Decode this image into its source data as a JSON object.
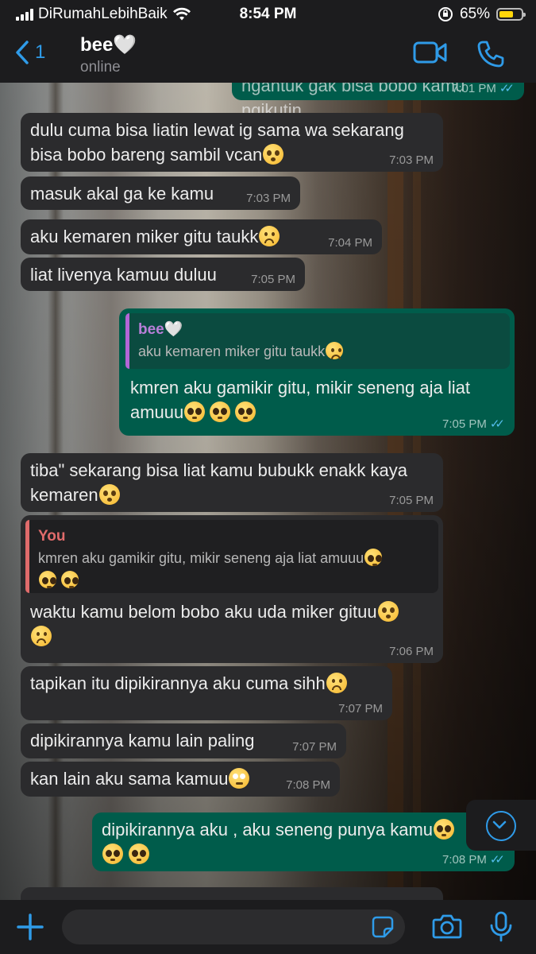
{
  "status_bar": {
    "carrier": "DiRumahLebihBaik",
    "time": "8:54 PM",
    "battery": "65%",
    "battery_level": 0.65
  },
  "header": {
    "back_count": "1",
    "contact_name": "bee🤍",
    "contact_status": "online",
    "icons": [
      "chevron-left-icon",
      "video-call-icon",
      "phone-icon"
    ]
  },
  "messages": [
    {
      "dir": "out",
      "text": "ngantuk gak bisa bobo kamu ngikutin",
      "time": "7:01 PM"
    },
    {
      "dir": "in",
      "text": "dulu cuma bisa liatin lewat ig sama wa sekarang bisa bobo bareng sambil vcan",
      "emoji": [
        "flushed"
      ],
      "time": "7:03 PM"
    },
    {
      "dir": "in",
      "text": "masuk akal ga ke kamu",
      "time": "7:03 PM"
    },
    {
      "dir": "in",
      "text": "aku kemaren miker gitu taukk",
      "emoji": [
        "frowning"
      ],
      "time": "7:04 PM"
    },
    {
      "dir": "in",
      "text": "liat livenya kamuu duluu",
      "time": "7:05 PM"
    },
    {
      "dir": "out",
      "quote_author": "bee🤍",
      "quote_text": "aku kemaren miker gitu taukk",
      "text": "kmren aku gamikir gitu, mikir seneng aja liat amuuu",
      "emoji": [
        "pleading",
        "pleading",
        "pleading"
      ],
      "time": "7:05 PM"
    },
    {
      "dir": "in",
      "text": "tiba\" sekarang bisa liat kamu bubukk enakk kaya kemaren",
      "emoji": [
        "flushed"
      ],
      "time": "7:05 PM"
    },
    {
      "dir": "in",
      "quote_author": "You",
      "quote_text": "kmren aku gamikir gitu, mikir seneng aja liat amuuu",
      "text": "waktu kamu belom bobo aku uda miker gituu",
      "emoji": [
        "flushed",
        "frowning"
      ],
      "time": "7:06 PM"
    },
    {
      "dir": "in",
      "text": "tapikan itu dipikirannya aku cuma sihh",
      "emoji": [
        "frowning"
      ],
      "time": "7:07 PM"
    },
    {
      "dir": "in",
      "text": "dipikirannya kamu lain paling",
      "time": "7:07 PM"
    },
    {
      "dir": "in",
      "text": "kan lain aku sama kamuu",
      "emoji": [
        "rolling-eyes"
      ],
      "time": "7:08 PM"
    },
    {
      "dir": "out",
      "text": "dipikirannya aku , aku seneng punya kamu",
      "emoji": [
        "pleading",
        "pleading",
        "pleading"
      ],
      "time": "7:08 PM"
    }
  ],
  "input_bar": {
    "icons": [
      "plus-icon",
      "sticker-icon",
      "camera-icon",
      "microphone-icon"
    ]
  },
  "colors": {
    "incoming_bubble": "#2b2b2d",
    "outgoing_bubble": "#005c4b",
    "accent": "#2f9be8",
    "read_ticks": "#53bdeb"
  }
}
